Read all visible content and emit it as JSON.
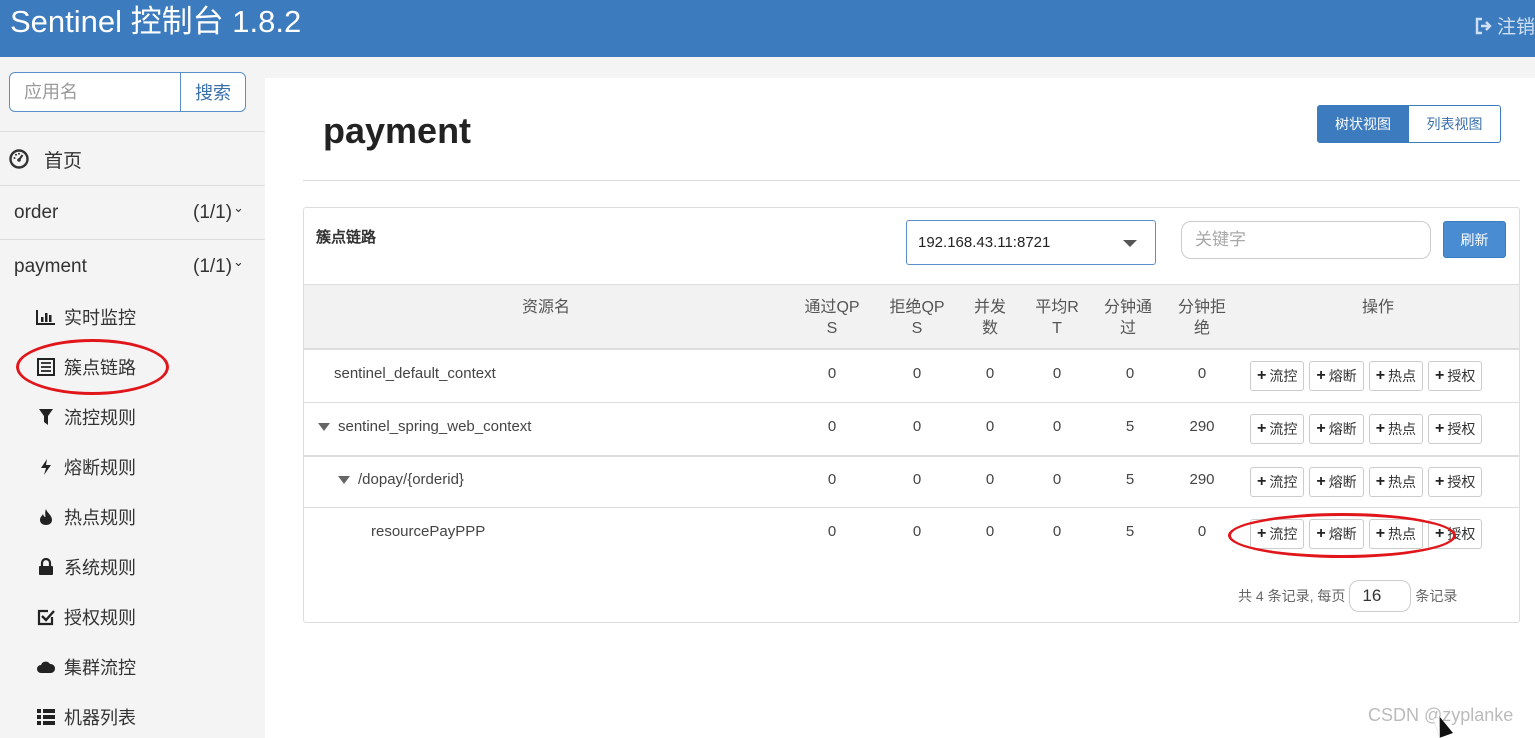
{
  "header": {
    "brand": "Sentinel 控制台 1.8.2",
    "logout_label": "注销",
    "bg_color": "#3c7bbe"
  },
  "sidebar": {
    "search_placeholder": "应用名",
    "search_button": "搜索",
    "home_label": "首页",
    "apps": [
      {
        "name": "order",
        "count": "(1/1)"
      },
      {
        "name": "payment",
        "count": "(1/1)"
      }
    ],
    "menu": [
      {
        "label": "实时监控",
        "icon": "bar-chart-icon"
      },
      {
        "label": "簇点链路",
        "icon": "list-icon"
      },
      {
        "label": "流控规则",
        "icon": "filter-icon"
      },
      {
        "label": "熔断规则",
        "icon": "bolt-icon"
      },
      {
        "label": "热点规则",
        "icon": "fire-icon"
      },
      {
        "label": "系统规则",
        "icon": "lock-icon"
      },
      {
        "label": "授权规则",
        "icon": "check-square-icon"
      },
      {
        "label": "集群流控",
        "icon": "cloud-icon"
      },
      {
        "label": "机器列表",
        "icon": "th-list-icon"
      }
    ]
  },
  "main": {
    "title": "payment",
    "view_tree": "树状视图",
    "view_list": "列表视图",
    "panel": {
      "title": "簇点链路",
      "machine": "192.168.43.11:8721",
      "keyword_placeholder": "关键字",
      "refresh": "刷新"
    },
    "columns": {
      "resource": "资源名",
      "pass_qps_1": "通过QP",
      "pass_qps_2": "S",
      "block_qps_1": "拒绝QP",
      "block_qps_2": "S",
      "concurrency_1": "并发",
      "concurrency_2": "数",
      "avg_rt_1": "平均R",
      "avg_rt_2": "T",
      "minute_pass_1": "分钟通",
      "minute_pass_2": "过",
      "minute_block_1": "分钟拒",
      "minute_block_2": "绝",
      "ops": "操作"
    },
    "rows": [
      {
        "name": "sentinel_default_context",
        "pass": "0",
        "block": "0",
        "conc": "0",
        "rt": "0",
        "mpass": "0",
        "mblock": "0"
      },
      {
        "name": "sentinel_spring_web_context",
        "pass": "0",
        "block": "0",
        "conc": "0",
        "rt": "0",
        "mpass": "5",
        "mblock": "290"
      },
      {
        "name": "/dopay/{orderid}",
        "pass": "0",
        "block": "0",
        "conc": "0",
        "rt": "0",
        "mpass": "5",
        "mblock": "290"
      },
      {
        "name": "resourcePayPPP",
        "pass": "0",
        "block": "0",
        "conc": "0",
        "rt": "0",
        "mpass": "5",
        "mblock": "0"
      }
    ],
    "op_labels": {
      "flow": "流控",
      "degrade": "熔断",
      "hot": "热点",
      "auth": "授权"
    },
    "pager": {
      "prefix": "共 4 条记录, 每页",
      "page_size": "16",
      "suffix": "条记录"
    }
  },
  "watermark": "CSDN @zyplanke"
}
